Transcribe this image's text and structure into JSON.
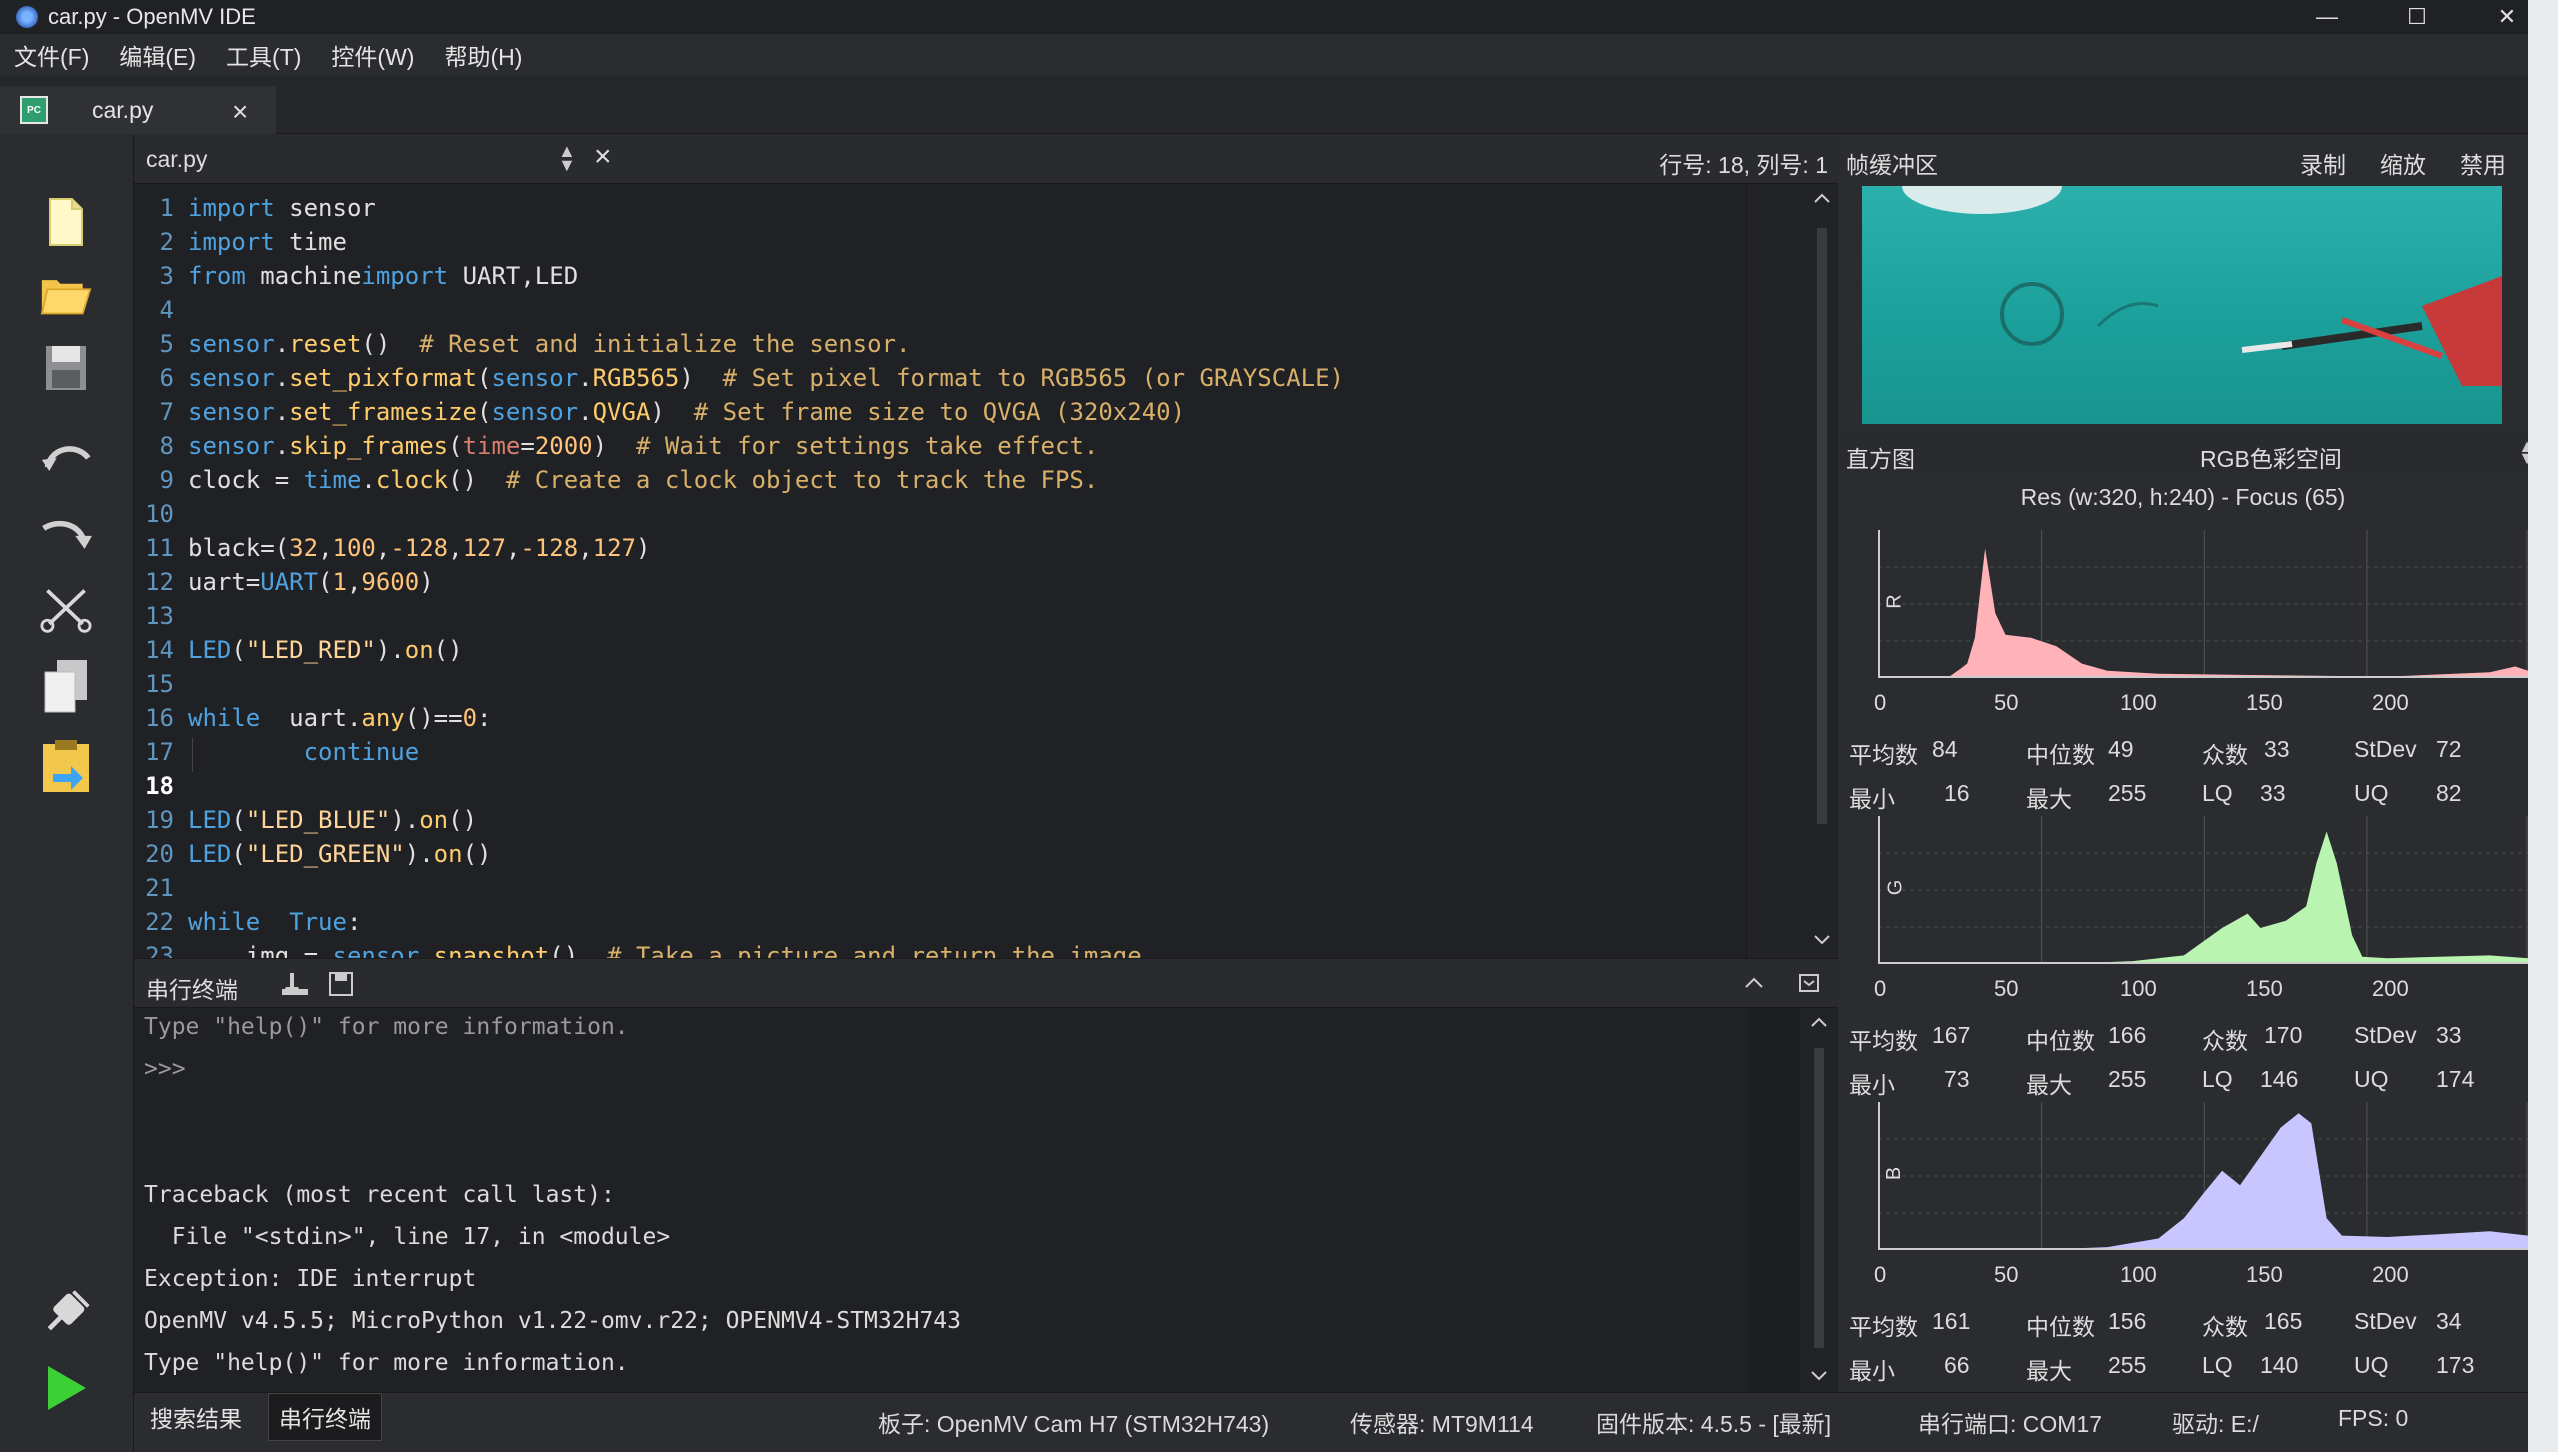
{
  "window": {
    "title": "car.py - OpenMV IDE",
    "controls": [
      "—",
      "☐",
      "✕"
    ]
  },
  "menu": [
    "文件(F)",
    "编辑(E)",
    "工具(T)",
    "控件(W)",
    "帮助(H)"
  ],
  "tab": {
    "name": "car.py",
    "icon": "PC"
  },
  "editor": {
    "file": "car.py",
    "cursor_position": "行号: 18, 列号: 1",
    "lines": [
      {
        "n": "1",
        "parts": [
          [
            "kw",
            "import"
          ],
          [
            "",
            "sensor"
          ]
        ]
      },
      {
        "n": "2",
        "parts": [
          [
            "kw",
            "import"
          ],
          [
            "",
            "time"
          ]
        ]
      },
      {
        "n": "3",
        "parts": [
          [
            "kw",
            "from"
          ],
          [
            "",
            "machine"
          ],
          [
            "kw",
            "import"
          ],
          [
            "",
            "UART,LED"
          ]
        ]
      },
      {
        "n": "4",
        "parts": []
      },
      {
        "n": "5",
        "parts": [
          [
            "kw",
            "sensor"
          ],
          [
            "",
            "."
          ],
          [
            "fn",
            "reset"
          ],
          [
            "",
            "()  "
          ],
          [
            "cm",
            "# Reset and initialize the sensor."
          ]
        ]
      },
      {
        "n": "6",
        "parts": [
          [
            "kw",
            "sensor"
          ],
          [
            "",
            "."
          ],
          [
            "fn",
            "set_pixformat"
          ],
          [
            "",
            "("
          ],
          [
            "kw",
            "sensor"
          ],
          [
            "",
            "."
          ],
          [
            "fn",
            "RGB565"
          ],
          [
            "",
            ")  "
          ],
          [
            "cm",
            "# Set pixel format to RGB565 (or GRAYSCALE)"
          ]
        ]
      },
      {
        "n": "7",
        "parts": [
          [
            "kw",
            "sensor"
          ],
          [
            "",
            "."
          ],
          [
            "fn",
            "set_framesize"
          ],
          [
            "",
            "("
          ],
          [
            "kw",
            "sensor"
          ],
          [
            "",
            "."
          ],
          [
            "fn",
            "QVGA"
          ],
          [
            "",
            ")  "
          ],
          [
            "cm",
            "# Set frame size to QVGA (320x240)"
          ]
        ]
      },
      {
        "n": "8",
        "parts": [
          [
            "kw",
            "sensor"
          ],
          [
            "",
            "."
          ],
          [
            "fn",
            "skip_frames"
          ],
          [
            "",
            "("
          ],
          [
            "kwarg",
            "time"
          ],
          [
            "",
            "="
          ],
          [
            "nm",
            "2000"
          ],
          [
            "",
            ")  "
          ],
          [
            "cm",
            "# Wait for settings take effect."
          ]
        ]
      },
      {
        "n": "9",
        "parts": [
          [
            "",
            "clock = "
          ],
          [
            "kw",
            "time"
          ],
          [
            "",
            "."
          ],
          [
            "fn",
            "clock"
          ],
          [
            "",
            "()  "
          ],
          [
            "cm",
            "# Create a clock object to track the FPS."
          ]
        ]
      },
      {
        "n": "10",
        "parts": []
      },
      {
        "n": "11",
        "parts": [
          [
            "",
            "black=("
          ],
          [
            "nm",
            "32"
          ],
          [
            "",
            ","
          ],
          [
            "nm",
            "100"
          ],
          [
            "",
            ","
          ],
          [
            "nm",
            "-128"
          ],
          [
            "",
            ","
          ],
          [
            "nm",
            "127"
          ],
          [
            "",
            ","
          ],
          [
            "nm",
            "-128"
          ],
          [
            "",
            ","
          ],
          [
            "nm",
            "127"
          ],
          [
            "",
            ")"
          ]
        ]
      },
      {
        "n": "12",
        "parts": [
          [
            "",
            "uart="
          ],
          [
            "kw",
            "UART"
          ],
          [
            "",
            "("
          ],
          [
            "nm",
            "1"
          ],
          [
            "",
            ","
          ],
          [
            "nm",
            "9600"
          ],
          [
            "",
            ")"
          ]
        ]
      },
      {
        "n": "13",
        "parts": []
      },
      {
        "n": "14",
        "parts": [
          [
            "kw",
            "LED"
          ],
          [
            "",
            "("
          ],
          [
            "st",
            "\"LED_RED\""
          ],
          [
            "",
            ")."
          ],
          [
            "fn",
            "on"
          ],
          [
            "",
            "()"
          ]
        ]
      },
      {
        "n": "15",
        "parts": []
      },
      {
        "n": "16",
        "parts": [
          [
            "kw",
            "while"
          ],
          [
            "",
            " uart."
          ],
          [
            "fn",
            "any"
          ],
          [
            "",
            "()=="
          ],
          [
            "nm",
            "0"
          ],
          [
            "",
            ":"
          ]
        ]
      },
      {
        "n": "17",
        "parts": [
          [
            "",
            "        "
          ],
          [
            "kw",
            "continue"
          ]
        ]
      },
      {
        "n": "18",
        "parts": []
      },
      {
        "n": "19",
        "parts": [
          [
            "kw",
            "LED"
          ],
          [
            "",
            "("
          ],
          [
            "st",
            "\"LED_BLUE\""
          ],
          [
            "",
            ")."
          ],
          [
            "fn",
            "on"
          ],
          [
            "",
            "()"
          ]
        ]
      },
      {
        "n": "20",
        "parts": [
          [
            "kw",
            "LED"
          ],
          [
            "",
            "("
          ],
          [
            "st",
            "\"LED_GREEN\""
          ],
          [
            "",
            ")."
          ],
          [
            "fn",
            "on"
          ],
          [
            "",
            "()"
          ]
        ]
      },
      {
        "n": "21",
        "parts": []
      },
      {
        "n": "22",
        "parts": [
          [
            "kw",
            "while"
          ],
          [
            "",
            " "
          ],
          [
            "kw",
            "True"
          ],
          [
            "",
            ":"
          ]
        ]
      },
      {
        "n": "23",
        "parts": [
          [
            "",
            "    img = "
          ],
          [
            "kw",
            "sensor"
          ],
          [
            "",
            "."
          ],
          [
            "fn",
            "snapshot"
          ],
          [
            "",
            "()  "
          ],
          [
            "cm",
            "# Take a picture and return the image."
          ]
        ]
      }
    ]
  },
  "terminal": {
    "title": "串行终端",
    "lines": [
      "Type \"help()\" for more information.",
      ">>>",
      "",
      "",
      "Traceback (most recent call last):",
      "  File \"<stdin>\", line 17, in <module>",
      "Exception: IDE interrupt",
      "OpenMV v4.5.5; MicroPython v1.22-omv.r22; OPENMV4-STM32H743",
      "Type \"help()\" for more information.",
      ">>>"
    ]
  },
  "bottom_tabs": [
    "搜索结果",
    "串行终端"
  ],
  "status": {
    "board": "板子: OpenMV Cam H7 (STM32H743)",
    "sensor": "传感器: MT9M114",
    "firmware": "固件版本: 4.5.5 - [最新]",
    "port": "串行端口: COM17",
    "drive": "驱动: E:/",
    "fps": "FPS: 0"
  },
  "framebuffer": {
    "title": "帧缓冲区",
    "buttons": [
      "录制",
      "缩放",
      "禁用"
    ]
  },
  "histogram": {
    "title": "直方图",
    "colorspace": "RGB色彩空间",
    "res": "Res (w:320, h:240) - Focus (65)",
    "axis_ticks": [
      "0",
      "50",
      "100",
      "150",
      "200"
    ],
    "channels": [
      {
        "name": "R",
        "color": "#ffb3b8",
        "stats": {
          "mean_l": "平均数",
          "mean": "84",
          "median_l": "中位数",
          "median": "49",
          "mode_l": "众数",
          "mode": "33",
          "stdev_l": "StDev",
          "stdev": "72",
          "min_l": "最小",
          "min": "16",
          "max_l": "最大",
          "max": "255",
          "lq_l": "LQ",
          "lq": "33",
          "uq_l": "UQ",
          "uq": "82"
        },
        "curve": [
          [
            0,
            0
          ],
          [
            20,
            0
          ],
          [
            28,
            1
          ],
          [
            32,
            6
          ],
          [
            35,
            10
          ],
          [
            38,
            28
          ],
          [
            42,
            90
          ],
          [
            46,
            45
          ],
          [
            50,
            30
          ],
          [
            60,
            28
          ],
          [
            70,
            22
          ],
          [
            80,
            10
          ],
          [
            90,
            5
          ],
          [
            110,
            3
          ],
          [
            150,
            2
          ],
          [
            200,
            1
          ],
          [
            240,
            4
          ],
          [
            250,
            8
          ],
          [
            255,
            5
          ]
        ]
      },
      {
        "name": "G",
        "color": "#b9f5b0",
        "stats": {
          "mean_l": "平均数",
          "mean": "167",
          "median_l": "中位数",
          "median": "166",
          "mode_l": "众数",
          "mode": "170",
          "stdev_l": "StDev",
          "stdev": "33",
          "min_l": "最小",
          "min": "73",
          "max_l": "最大",
          "max": "255",
          "lq_l": "LQ",
          "lq": "146",
          "uq_l": "UQ",
          "uq": "174"
        },
        "curve": [
          [
            0,
            0
          ],
          [
            70,
            0
          ],
          [
            100,
            2
          ],
          [
            120,
            6
          ],
          [
            135,
            25
          ],
          [
            145,
            35
          ],
          [
            150,
            25
          ],
          [
            160,
            30
          ],
          [
            168,
            40
          ],
          [
            172,
            70
          ],
          [
            176,
            92
          ],
          [
            180,
            70
          ],
          [
            186,
            20
          ],
          [
            190,
            5
          ],
          [
            200,
            4
          ],
          [
            220,
            5
          ],
          [
            240,
            6
          ],
          [
            255,
            4
          ]
        ]
      },
      {
        "name": "B",
        "color": "#c9c6ff",
        "stats": {
          "mean_l": "平均数",
          "mean": "161",
          "median_l": "中位数",
          "median": "156",
          "mode_l": "众数",
          "mode": "165",
          "stdev_l": "StDev",
          "stdev": "34",
          "min_l": "最小",
          "min": "66",
          "max_l": "最大",
          "max": "255",
          "lq_l": "LQ",
          "lq": "140",
          "uq_l": "UQ",
          "uq": "173"
        },
        "curve": [
          [
            0,
            0
          ],
          [
            60,
            0
          ],
          [
            90,
            2
          ],
          [
            110,
            8
          ],
          [
            120,
            22
          ],
          [
            128,
            40
          ],
          [
            135,
            55
          ],
          [
            142,
            45
          ],
          [
            150,
            65
          ],
          [
            158,
            85
          ],
          [
            165,
            95
          ],
          [
            170,
            88
          ],
          [
            176,
            22
          ],
          [
            182,
            10
          ],
          [
            200,
            9
          ],
          [
            220,
            11
          ],
          [
            240,
            13
          ],
          [
            255,
            10
          ]
        ]
      }
    ]
  }
}
